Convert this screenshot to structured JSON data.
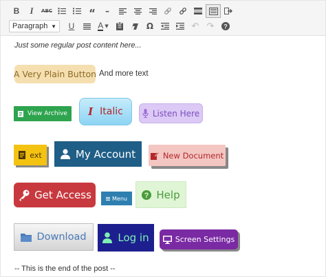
{
  "toolbar": {
    "row1": [
      {
        "name": "bold-button",
        "glyph": "B"
      },
      {
        "name": "italic-button",
        "glyph": "I"
      },
      {
        "name": "strikethrough-button",
        "glyph": "ABC"
      },
      {
        "name": "bulleted-list-button",
        "glyph": "☰"
      },
      {
        "name": "numbered-list-button",
        "glyph": "☰"
      },
      {
        "name": "blockquote-button",
        "glyph": "❝"
      },
      {
        "name": "horizontal-line-button",
        "glyph": "—"
      },
      {
        "name": "align-left-button",
        "glyph": "≡"
      },
      {
        "name": "align-center-button",
        "glyph": "≡"
      },
      {
        "name": "align-right-button",
        "glyph": "≡"
      },
      {
        "name": "insert-link-button",
        "glyph": "🔗"
      },
      {
        "name": "remove-link-button",
        "glyph": "⛓"
      },
      {
        "name": "read-more-button",
        "glyph": "▬"
      },
      {
        "name": "toolbar-toggle-button",
        "glyph": "▦"
      },
      {
        "name": "distraction-free-button",
        "glyph": "⇥"
      }
    ],
    "format_select": {
      "value": "Paragraph"
    },
    "row2": [
      {
        "name": "underline-button",
        "glyph": "U"
      },
      {
        "name": "justify-button",
        "glyph": "≣"
      },
      {
        "name": "text-color-button",
        "glyph": "A"
      },
      {
        "name": "paste-as-text-button",
        "glyph": "📋"
      },
      {
        "name": "clear-formatting-button",
        "glyph": "⌫"
      },
      {
        "name": "special-character-button",
        "glyph": "Ω"
      },
      {
        "name": "decrease-indent-button",
        "glyph": "⇤"
      },
      {
        "name": "increase-indent-button",
        "glyph": "⇥"
      },
      {
        "name": "undo-button",
        "glyph": "↶"
      },
      {
        "name": "redo-button",
        "glyph": "↷"
      },
      {
        "name": "help-button",
        "glyph": "?"
      }
    ]
  },
  "content": {
    "intro": "Just some regular post content here...",
    "outro": "-- This is the end of the post --",
    "plain_after": "And more text"
  },
  "buttons": {
    "plain": "A Very Plain Button",
    "view_archive": "View Archive",
    "italic": "Italic",
    "listen_here": "Listen Here",
    "ext": "ext",
    "my_account": "My Account",
    "new_document": "New Document",
    "get_access": "Get Access",
    "menu": "Menu",
    "help": "Help",
    "download": "Download",
    "log_in": "Log in",
    "screen_settings": "Screen Settings"
  },
  "icons": {
    "view_archive": "archive-icon",
    "italic": "italic-icon",
    "listen_here": "microphone-icon",
    "ext": "document-icon",
    "my_account": "user-icon",
    "new_document": "edit-document-icon",
    "get_access": "key-icon",
    "menu": "menu-icon",
    "help": "help-circle-icon",
    "download": "folder-icon",
    "log_in": "user-icon",
    "screen_settings": "monitor-icon"
  },
  "colors": {
    "plain_bg": "#f5dfb0",
    "view_archive_bg": "#2ea44f",
    "italic_bg": "#8dd4f3",
    "listen_bg": "#dcc9f5",
    "ext_bg": "#f4c211",
    "account_bg": "#1f5e86",
    "newdoc_bg": "#f3c6c2",
    "get_access_bg": "#c8393f",
    "menu_bg": "#2e7fb0",
    "help_bg": "#dff5d5",
    "download_bg": "#d4d4d4",
    "login_bg": "#1d1f8f",
    "screen_settings_bg": "#7a2aa3"
  }
}
